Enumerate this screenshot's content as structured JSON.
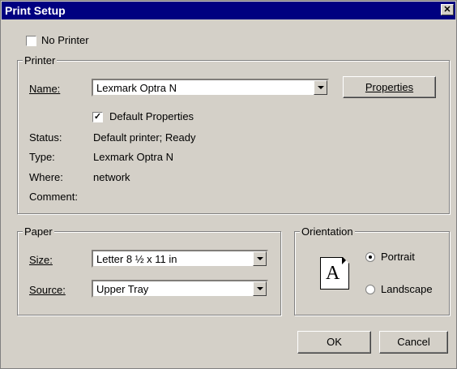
{
  "window": {
    "title": "Print Setup",
    "close_glyph": "✕"
  },
  "no_printer": {
    "label": "No Printer",
    "checked": false
  },
  "printer_group": {
    "legend": "Printer",
    "name_label": "Name:",
    "name_value": "Lexmark Optra N",
    "properties_button": "Properties",
    "default_props": {
      "label": "Default Properties",
      "checked": true
    },
    "status_label": "Status:",
    "status_value": "Default printer; Ready",
    "type_label": "Type:",
    "type_value": "Lexmark Optra N",
    "where_label": "Where:",
    "where_value": "network",
    "comment_label": "Comment:",
    "comment_value": ""
  },
  "paper_group": {
    "legend": "Paper",
    "size_label": "Size:",
    "size_value": "Letter 8 ½ x 11 in",
    "source_label": "Source:",
    "source_value": "Upper Tray"
  },
  "orientation_group": {
    "legend": "Orientation",
    "icon_letter": "A",
    "portrait_label": "Portrait",
    "portrait_selected": true,
    "landscape_label": "Landscape",
    "landscape_selected": false
  },
  "buttons": {
    "ok": "OK",
    "cancel": "Cancel"
  }
}
